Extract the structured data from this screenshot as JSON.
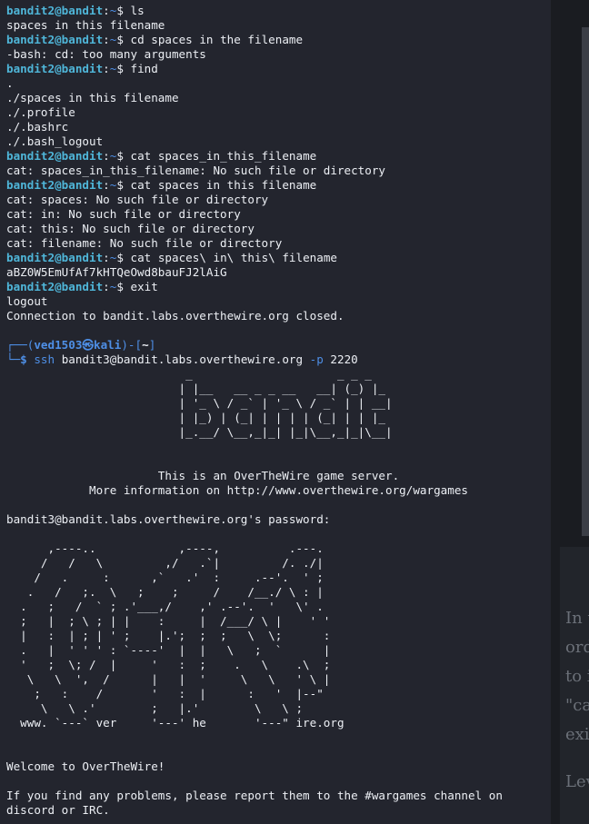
{
  "terminal": {
    "prompt": {
      "remote_user_host": "bandit2@bandit",
      "path": "~",
      "symbol": "$"
    },
    "local_prompt": {
      "corner_top": "┌──(",
      "user": "ved1503",
      "skull": "㉿",
      "host": "kali",
      "path_open": ")-[",
      "path": "~",
      "path_close": "]",
      "corner_bottom": "└─",
      "symbol": "$"
    },
    "ssh_command": {
      "cmd": "ssh",
      "target": "bandit3@bandit.labs.overthewire.org",
      "flag": "-p",
      "port": "2220"
    },
    "session_commands": [
      {
        "cmd": "ls",
        "output": [
          "spaces in this filename"
        ]
      },
      {
        "cmd": "cd spaces in the filename",
        "output": [
          "-bash: cd: too many arguments"
        ]
      },
      {
        "cmd": "find",
        "output": [
          ".",
          "./spaces in this filename",
          "./.profile",
          "./.bashrc",
          "./.bash_logout"
        ]
      },
      {
        "cmd": "cat spaces_in_this_filename",
        "output": [
          "cat: spaces_in_this_filename: No such file or directory"
        ]
      },
      {
        "cmd": "cat spaces in this filename",
        "output": [
          "cat: spaces: No such file or directory",
          "cat: in: No such file or directory",
          "cat: this: No such file or directory",
          "cat: filename: No such file or directory"
        ]
      },
      {
        "cmd": "cat spaces\\ in\\ this\\ filename",
        "output": [
          "aBZ0W5EmUfAf7kHTQeOwd8bauFJ2lAiG"
        ]
      },
      {
        "cmd": "exit",
        "output": [
          "logout",
          "Connection to bandit.labs.overthewire.org closed."
        ]
      }
    ],
    "bandit_banner": [
      "                          _                     _ _ _   ",
      "                         | |__   __ _ _ __   __| (_) |_ ",
      "                         | '_ \\ / _` | '_ \\ / _` | | __|",
      "                         | |_) | (_| | | | | (_| | | |_ ",
      "                         |_.__/ \\__,_|_| |_|\\__,_|_|\\__|"
    ],
    "server_info": [
      "                      This is an OverTheWire game server.",
      "            More information on http://www.overthewire.org/wargames"
    ],
    "password_prompt": "bandit3@bandit.labs.overthewire.org's password:",
    "otw_art": [
      "      ,----..            ,----,          .---.",
      "     /   /   \\         ,/   .`|         /. ./|",
      "    /   .     :      ,`   .'  :     .--'.  ' ;",
      "   .   /   ;.  \\   ;    ;     /    /__./ \\ : |",
      "  .   ;   /  ` ; .'___,/    ,' .--'.  '   \\' .",
      "  ;   |  ; \\ ; | |    :     |  /___/ \\ |    ' '",
      "  |   :  | ; | ' ;    |.';  ;  ;   \\  \\;      :",
      "  .   |  ' ' ' : `----'  |  |   \\   ;  `      |",
      "  '   ;  \\; /  |     '   :  ;    .   \\    .\\  ;",
      "   \\   \\  ',  /      |   |  '     \\   \\   ' \\ |",
      "    ;   :    /       '   :  |      :   '  |--\"",
      "     \\   \\ .'        ;   |.'        \\   \\ ;",
      "  www. `---` ver     '---' he       '---\" ire.org"
    ],
    "welcome": "Welcome to OverTheWire!",
    "report_lines": [
      "If you find any problems, please report them to the #wargames channel on",
      "discord or IRC."
    ]
  },
  "background_page": {
    "lines": [
      "In t",
      "ord",
      "to i",
      "\"ca",
      "exi",
      "Lev"
    ]
  },
  "colors": {
    "terminal_bg": "#23252e",
    "prompt_user": "#4fb6d9",
    "kali_blue": "#4e8fe6",
    "text": "#eceff4"
  }
}
